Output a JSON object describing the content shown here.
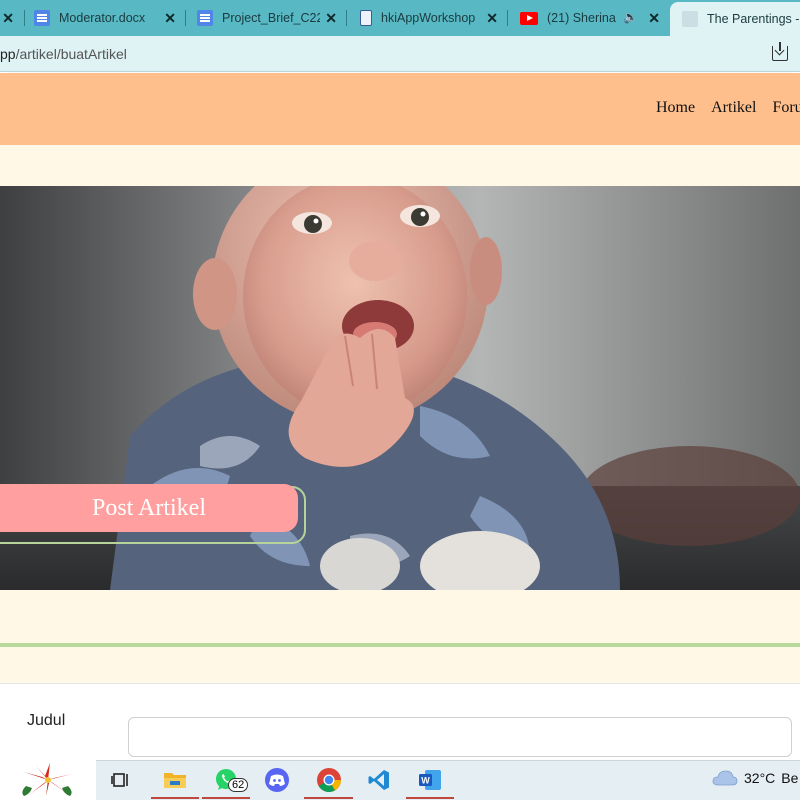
{
  "browser": {
    "tabs": [
      {
        "title": "",
        "icon": "close-icon",
        "active": false
      },
      {
        "title": "Moderator.docx",
        "icon": "google-docs-icon",
        "active": false
      },
      {
        "title": "Project_Brief_C22",
        "icon": "google-docs-icon",
        "active": false
      },
      {
        "title": "hkiAppWorkshop",
        "icon": "file-icon",
        "active": false
      },
      {
        "title": "(21) Sherina",
        "icon": "youtube-icon",
        "active": false,
        "audio": true
      },
      {
        "title": "The Parentings -",
        "icon": "globe-icon",
        "active": true
      }
    ],
    "url_prefix": "pp",
    "url_path": "/artikel/buatArtikel"
  },
  "site": {
    "nav": [
      "Home",
      "Artikel",
      "Forum"
    ],
    "hero_button": "Post Artikel",
    "form": {
      "label_title": "Judul",
      "title_value": ""
    }
  },
  "taskbar": {
    "whatsapp_badge": "62",
    "temperature": "32°C",
    "weather_text": "Be"
  },
  "colors": {
    "tabstrip": "#58b8c3",
    "header": "#ffbf8c",
    "cream": "#fff8e6",
    "button": "#ff9f9f",
    "accent_green": "#b8d99c"
  }
}
